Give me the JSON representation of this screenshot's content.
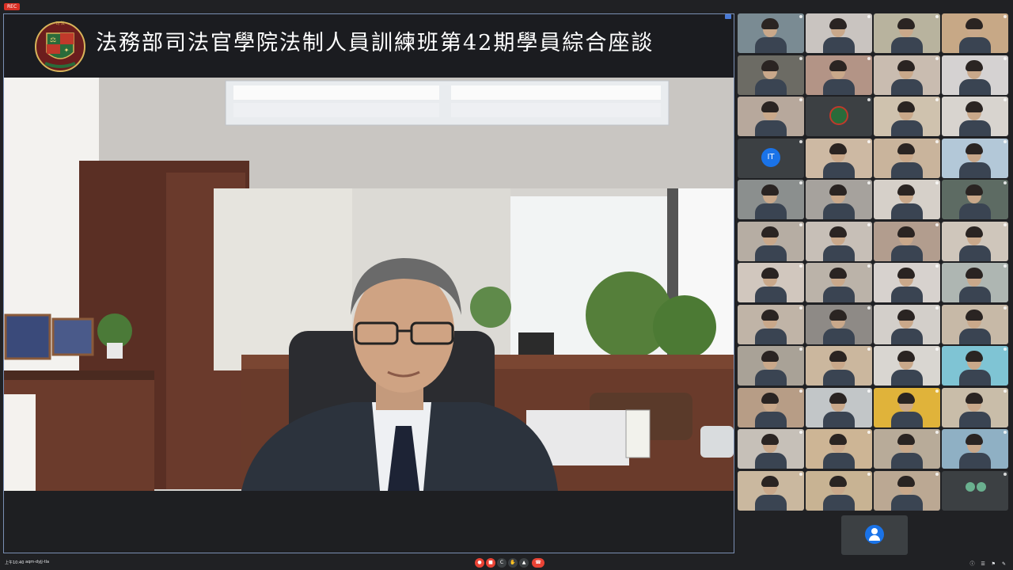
{
  "recording_badge": "REC",
  "banner": {
    "title": "法務部司法官學院法制人員訓練班第42期學員綜合座談"
  },
  "main_speaker_tag": "",
  "participants": [
    {
      "bg": "#7a8b93",
      "kind": "person"
    },
    {
      "bg": "#c9c4c0",
      "kind": "person"
    },
    {
      "bg": "#b8b39e",
      "kind": "person"
    },
    {
      "bg": "#c7a886",
      "kind": "person"
    },
    {
      "bg": "#6c6b64",
      "kind": "person"
    },
    {
      "bg": "#b39486",
      "kind": "person"
    },
    {
      "bg": "#c9bcb0",
      "kind": "person"
    },
    {
      "bg": "#d5d2d2",
      "kind": "person"
    },
    {
      "bg": "#b7a89c",
      "kind": "person"
    },
    {
      "bg": "#3c4043",
      "kind": "logo"
    },
    {
      "bg": "#cfc2ae",
      "kind": "person"
    },
    {
      "bg": "#d8d4cf",
      "kind": "person"
    },
    {
      "bg": "#3c4043",
      "kind": "initials",
      "initials": "IT"
    },
    {
      "bg": "#cdb9a3",
      "kind": "person"
    },
    {
      "bg": "#c9b49c",
      "kind": "person"
    },
    {
      "bg": "#b3c8d8",
      "kind": "person"
    },
    {
      "bg": "#8b8f8e",
      "kind": "person"
    },
    {
      "bg": "#a6a29d",
      "kind": "person"
    },
    {
      "bg": "#d6d0c9",
      "kind": "person"
    },
    {
      "bg": "#5d6b63",
      "kind": "person"
    },
    {
      "bg": "#b6ada3",
      "kind": "person"
    },
    {
      "bg": "#c7bfb7",
      "kind": "person"
    },
    {
      "bg": "#b29d8e",
      "kind": "person"
    },
    {
      "bg": "#cfc6bb",
      "kind": "person"
    },
    {
      "bg": "#d1c7be",
      "kind": "person"
    },
    {
      "bg": "#bbb3a9",
      "kind": "person"
    },
    {
      "bg": "#d7d2ce",
      "kind": "person"
    },
    {
      "bg": "#aeb6b2",
      "kind": "person"
    },
    {
      "bg": "#c0b4a7",
      "kind": "person"
    },
    {
      "bg": "#8e8a86",
      "kind": "person"
    },
    {
      "bg": "#d3cfca",
      "kind": "person"
    },
    {
      "bg": "#c7b9a7",
      "kind": "person"
    },
    {
      "bg": "#a9a297",
      "kind": "person"
    },
    {
      "bg": "#cbb79e",
      "kind": "person"
    },
    {
      "bg": "#d9d6d1",
      "kind": "person"
    },
    {
      "bg": "#7fc4d4",
      "kind": "person"
    },
    {
      "bg": "#b79d86",
      "kind": "person"
    },
    {
      "bg": "#c2c6c8",
      "kind": "person"
    },
    {
      "bg": "#e0b33a",
      "kind": "person"
    },
    {
      "bg": "#c9bda9",
      "kind": "person"
    },
    {
      "bg": "#c6c0b8",
      "kind": "person"
    },
    {
      "bg": "#cdb595",
      "kind": "person"
    },
    {
      "bg": "#b8ab99",
      "kind": "person"
    },
    {
      "bg": "#8fb0c4",
      "kind": "person"
    },
    {
      "bg": "#cab89f",
      "kind": "person"
    },
    {
      "bg": "#c8b393",
      "kind": "person"
    },
    {
      "bg": "#bba893",
      "kind": "person"
    },
    {
      "bg": "#3c4043",
      "kind": "pair"
    }
  ],
  "toolbar": {
    "clock": "上午10:40",
    "meet_code": "aqm-dyjj-tla",
    "buttons": [
      "mic",
      "cam",
      "cc",
      "hand",
      "present",
      "more",
      "end"
    ]
  },
  "colors": {
    "accent": "#1a73e8",
    "danger": "#ea4335",
    "bg": "#202124"
  }
}
